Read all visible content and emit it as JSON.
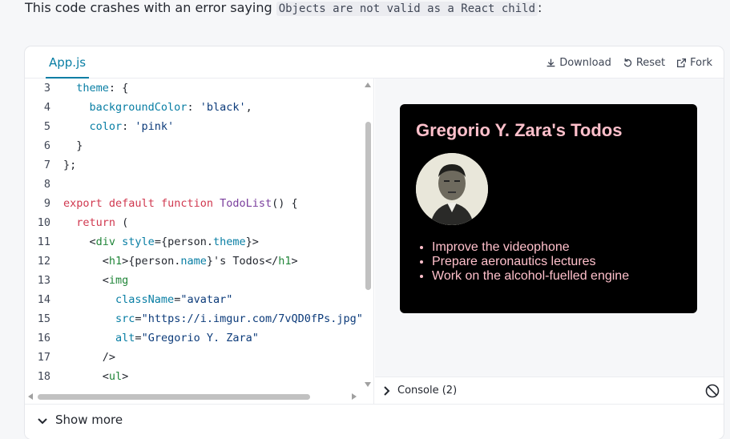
{
  "intro": {
    "text": "This code crashes with an error saying",
    "code": "Objects are not valid as a React child",
    "suffix": ":"
  },
  "sandbox": {
    "tab": "App.js",
    "actions": {
      "download": "Download",
      "reset": "Reset",
      "fork": "Fork"
    },
    "code_lines": [
      {
        "n": "3",
        "text": "  theme: {"
      },
      {
        "n": "4",
        "text": "    backgroundColor: 'black',"
      },
      {
        "n": "5",
        "text": "    color: 'pink'"
      },
      {
        "n": "6",
        "text": "  }"
      },
      {
        "n": "7",
        "text": "};"
      },
      {
        "n": "8",
        "text": ""
      },
      {
        "n": "9",
        "text": "export default function TodoList() {"
      },
      {
        "n": "10",
        "text": "  return ("
      },
      {
        "n": "11",
        "text": "    <div style={person.theme}>"
      },
      {
        "n": "12",
        "text": "      <h1>{person.name}'s Todos</h1>"
      },
      {
        "n": "13",
        "text": "      <img"
      },
      {
        "n": "14",
        "text": "        className=\"avatar\""
      },
      {
        "n": "15",
        "text": "        src=\"https://i.imgur.com/7vQD0fPs.jpg\""
      },
      {
        "n": "16",
        "text": "        alt=\"Gregorio Y. Zara\""
      },
      {
        "n": "17",
        "text": "      />"
      },
      {
        "n": "18",
        "text": "      <ul>"
      }
    ],
    "preview": {
      "heading": "Gregorio Y. Zara's Todos",
      "avatar_alt": "Gregorio Y. Zara",
      "todos": [
        "Improve the videophone",
        "Prepare aeronautics lectures",
        "Work on the alcohol-fuelled engine"
      ]
    },
    "console_label": "Console (2)",
    "show_more": "Show more"
  },
  "colors": {
    "accent": "#087ea4",
    "card_bg": "#000000",
    "card_text": "pink"
  }
}
